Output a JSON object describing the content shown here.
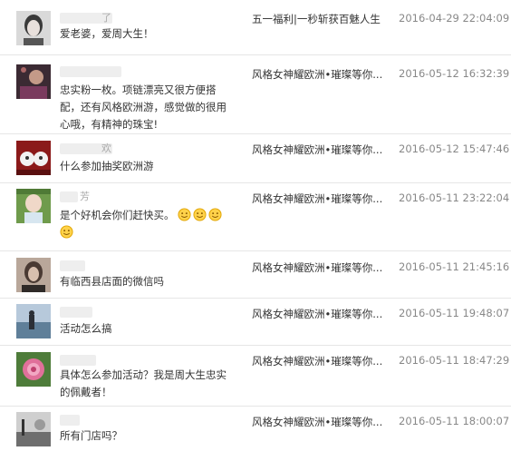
{
  "comments": [
    {
      "user": "了",
      "text": "爱老婆，爱周大生！",
      "article": "五一福利|一秒斩获百魅人生",
      "time": "2016-04-29 22:04:09",
      "avatar": "grey-portrait"
    },
    {
      "user": "",
      "text": "忠实粉一枚。项链漂亮又很方便搭配，还有风格欧洲游，感觉做的很用心哦，有精神的珠宝!",
      "article": "风格女神耀欧洲•璀璨等你...",
      "time": "2016-05-12 16:32:39",
      "avatar": "dark-photo"
    },
    {
      "user": "欢",
      "text": "什么参加抽奖欧洲游",
      "article": "风格女神耀欧洲•璀璨等你...",
      "time": "2016-05-12 15:47:46",
      "avatar": "red-toys"
    },
    {
      "user": "芳",
      "text": "是个好机会你们赶快买。",
      "emoji_count": 4,
      "article": "风格女神耀欧洲•璀璨等你...",
      "time": "2016-05-11 23:22:04",
      "avatar": "child-green"
    },
    {
      "user": "",
      "text": "有临西县店面的微信吗",
      "article": "风格女神耀欧洲•璀璨等你...",
      "time": "2016-05-11 21:45:16",
      "avatar": "blurred-face"
    },
    {
      "user": "",
      "text": "活动怎么搞",
      "article": "风格女神耀欧洲•璀璨等你...",
      "time": "2016-05-11 19:48:07",
      "avatar": "sea-scene"
    },
    {
      "user": "",
      "text": "具体怎么参加活动？我是周大生忠实的佩戴者！",
      "article": "风格女神耀欧洲•璀璨等你...",
      "time": "2016-05-11 18:47:29",
      "avatar": "pink-flower"
    },
    {
      "user": "",
      "text": "所有门店吗？",
      "article": "风格女神耀欧洲•璀璨等你...",
      "time": "2016-05-11 18:00:07",
      "avatar": "bw-landscape"
    }
  ]
}
